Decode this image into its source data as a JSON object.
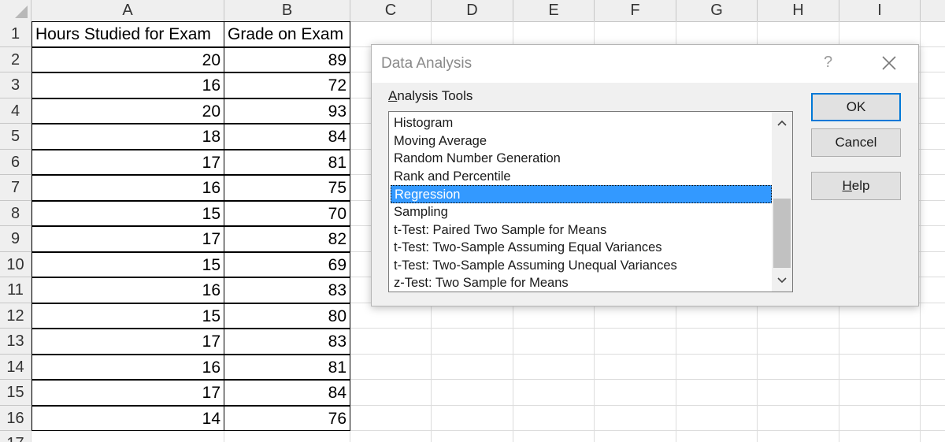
{
  "sheet": {
    "columns": [
      "A",
      "B",
      "C",
      "D",
      "E",
      "F",
      "G",
      "H",
      "I"
    ],
    "rows": [
      "1",
      "2",
      "3",
      "4",
      "5",
      "6",
      "7",
      "8",
      "9",
      "10",
      "11",
      "12",
      "13",
      "14",
      "15",
      "16",
      "17"
    ],
    "headers": [
      "Hours Studied for Exam",
      "Grade on Exam"
    ],
    "data": [
      [
        "20",
        "89"
      ],
      [
        "16",
        "72"
      ],
      [
        "20",
        "93"
      ],
      [
        "18",
        "84"
      ],
      [
        "17",
        "81"
      ],
      [
        "16",
        "75"
      ],
      [
        "15",
        "70"
      ],
      [
        "17",
        "82"
      ],
      [
        "15",
        "69"
      ],
      [
        "16",
        "83"
      ],
      [
        "15",
        "80"
      ],
      [
        "17",
        "83"
      ],
      [
        "16",
        "81"
      ],
      [
        "17",
        "84"
      ],
      [
        "14",
        "76"
      ]
    ]
  },
  "dialog": {
    "title": "Data Analysis",
    "help_glyph": "?",
    "tools_label_underlined": "A",
    "tools_label_rest": "nalysis Tools",
    "items": [
      "Histogram",
      "Moving Average",
      "Random Number Generation",
      "Rank and Percentile",
      "Regression",
      "Sampling",
      "t-Test: Paired Two Sample for Means",
      "t-Test: Two-Sample Assuming Equal Variances",
      "t-Test: Two-Sample Assuming Unequal Variances",
      "z-Test: Two Sample for Means"
    ],
    "selected_index": 4,
    "buttons": {
      "ok": "OK",
      "cancel": "Cancel",
      "help_underlined": "H",
      "help_rest": "elp"
    }
  },
  "colors": {
    "selection": "#3399ff",
    "default_button_border": "#0078d7",
    "header_bg": "#efefef"
  }
}
